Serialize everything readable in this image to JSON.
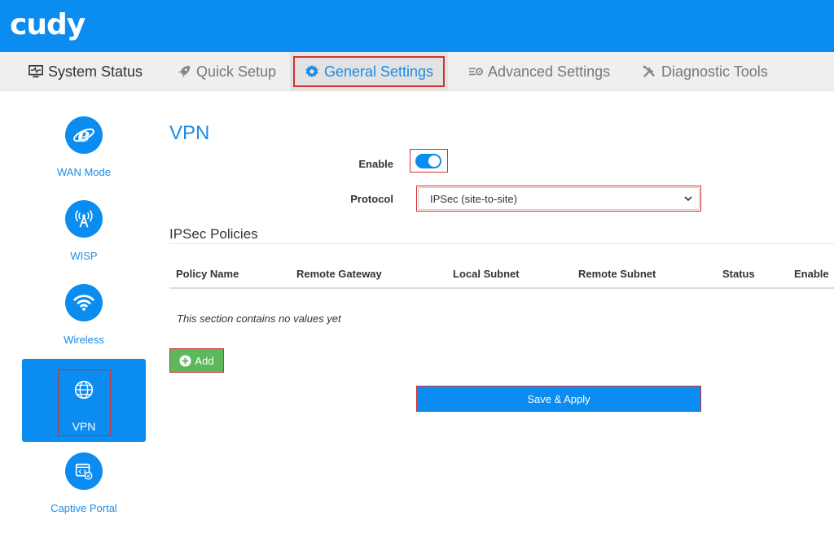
{
  "header": {
    "logo_text": "cudy",
    "brand_color": "#0a8cf0"
  },
  "nav": {
    "tabs": [
      {
        "label": "System Status",
        "icon": "monitor-pulse-icon"
      },
      {
        "label": "Quick Setup",
        "icon": "rocket-icon"
      },
      {
        "label": "General Settings",
        "icon": "gear-icon",
        "active": true
      },
      {
        "label": "Advanced Settings",
        "icon": "sliders-gear-icon"
      },
      {
        "label": "Diagnostic Tools",
        "icon": "tools-icon"
      }
    ]
  },
  "sidebar": {
    "items": [
      {
        "label": "WAN Mode",
        "icon": "internet-explorer-icon"
      },
      {
        "label": "WISP",
        "icon": "antenna-icon"
      },
      {
        "label": "Wireless",
        "icon": "wifi-icon"
      },
      {
        "label": "VPN",
        "icon": "globe-icon",
        "active": true
      },
      {
        "label": "Captive Portal",
        "icon": "portal-icon"
      }
    ]
  },
  "main": {
    "title": "VPN",
    "enable_label": "Enable",
    "enable_value": true,
    "protocol_label": "Protocol",
    "protocol_value": "IPSec (site-to-site)",
    "section_title": "IPSec Policies",
    "table": {
      "columns": [
        "Policy Name",
        "Remote Gateway",
        "Local Subnet",
        "Remote Subnet",
        "Status",
        "Enable"
      ],
      "empty_text": "This section contains no values yet"
    },
    "add_label": "Add",
    "save_label": "Save & Apply"
  }
}
